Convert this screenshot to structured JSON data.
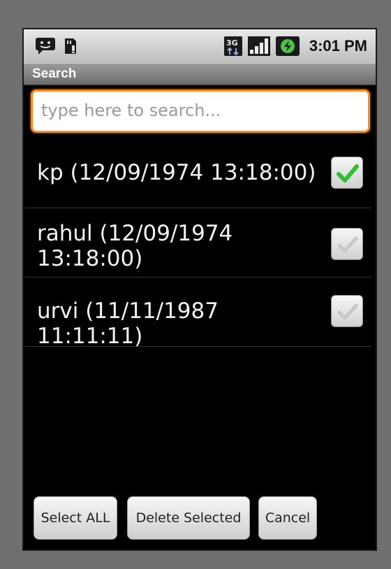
{
  "status_bar": {
    "time": "3:01 PM",
    "icons": [
      "chat-notification-icon",
      "sd-card-warning-icon",
      "3g-data-icon",
      "signal-bars-icon",
      "battery-charging-icon"
    ]
  },
  "title_bar": {
    "title": "Search"
  },
  "search": {
    "placeholder": "type here to search...",
    "value": ""
  },
  "list": {
    "items": [
      {
        "label": "kp (12/09/1974 13:18:00)",
        "checked": true
      },
      {
        "label": "rahul (12/09/1974 13:18:00)",
        "checked": false
      },
      {
        "label": "urvi (11/11/1987 11:11:11)",
        "checked": false
      }
    ]
  },
  "buttons": {
    "select_all": "Select ALL",
    "delete_selected": "Delete Selected",
    "cancel": "Cancel"
  },
  "colors": {
    "accent": "#ff8c1a",
    "check_green": "#2fbf2f"
  }
}
